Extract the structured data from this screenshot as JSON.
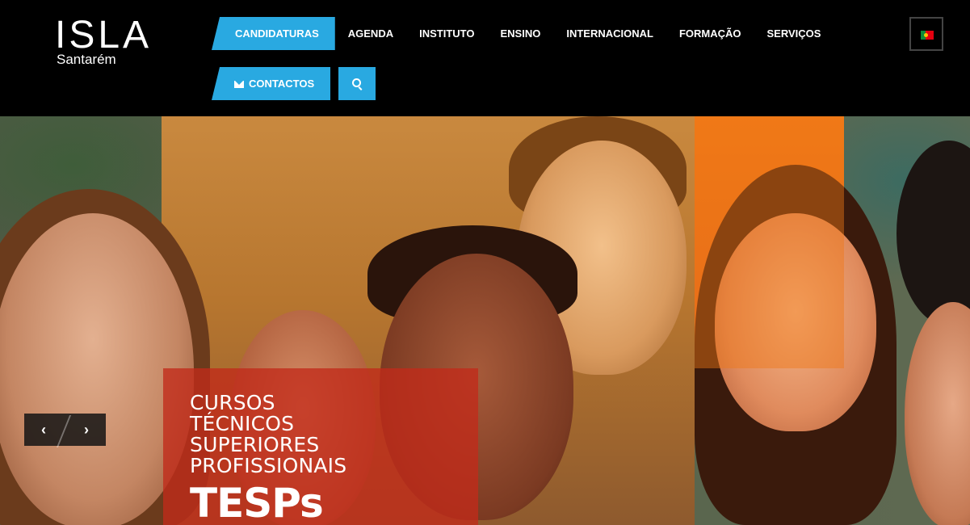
{
  "logo": {
    "mark": "ISLA",
    "subtitle": "Santarém"
  },
  "nav": {
    "row1": [
      {
        "label": "CANDIDATURAS",
        "active": true
      },
      {
        "label": "AGENDA"
      },
      {
        "label": "INSTITUTO"
      },
      {
        "label": "ENSINO"
      },
      {
        "label": "INTERNACIONAL"
      },
      {
        "label": "FORMAÇÃO"
      },
      {
        "label": "SERVIÇOS"
      }
    ],
    "contacts_label": "CONTACTOS",
    "search_icon": "search-icon",
    "contacts_icon": "envelope-icon"
  },
  "language": {
    "icon": "portugal-flag-icon"
  },
  "hero": {
    "lines": [
      "CURSOS",
      "TÉCNICOS",
      "SUPERIORES",
      "PROFISSIONAIS"
    ],
    "brand": "TESPs",
    "prev_icon": "chevron-left-icon",
    "next_icon": "chevron-right-icon"
  },
  "colors": {
    "accent": "#29a9e1",
    "header_bg": "#000000",
    "hero_red": "#c22a1a",
    "hero_orange": "#f07a18"
  }
}
